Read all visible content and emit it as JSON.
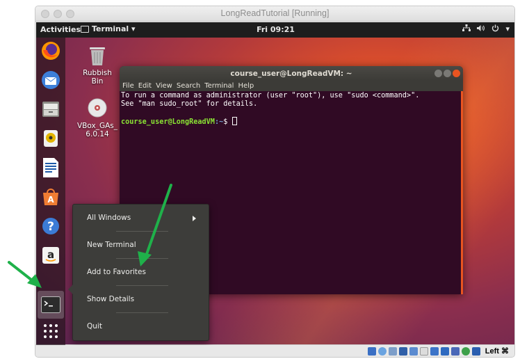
{
  "vm_window": {
    "title": "LongReadTutorial [Running]"
  },
  "topbar": {
    "activities": "Activities",
    "app_menu": "Terminal ▾",
    "clock": "Fri 09:21",
    "tray": [
      "network-icon",
      "volume-icon",
      "power-icon",
      "▾"
    ]
  },
  "desktop_icons": [
    {
      "label": "Rubbish Bin",
      "icon": "trash-icon"
    },
    {
      "label": "VBox_GAs_\n6.0.14",
      "icon": "disc-icon"
    }
  ],
  "dock": [
    "firefox-icon",
    "thunderbird-icon",
    "files-icon",
    "rhythmbox-icon",
    "writer-icon",
    "software-icon",
    "help-icon",
    "amazon-icon",
    "terminal-icon",
    "app-grid-icon"
  ],
  "terminal": {
    "title": "course_user@LongReadVM: ~",
    "menu": [
      "File",
      "Edit",
      "View",
      "Search",
      "Terminal",
      "Help"
    ],
    "line1": "To run a command as administrator (user \"root\"), use \"sudo <command>\".",
    "line2": "See \"man sudo_root\" for details.",
    "prompt_user": "course_user@LongReadVM",
    "prompt_path": ":~",
    "prompt_symbol": "$ "
  },
  "context_menu": {
    "items": [
      "All Windows",
      "New Terminal",
      "Add to Favorites",
      "Show Details",
      "Quit"
    ]
  },
  "status_bar": {
    "host_key": "Left ⌘"
  },
  "colors": {
    "terminal_bg": "#300a24",
    "accent": "#e95420",
    "annotation": "#1fb14a"
  }
}
